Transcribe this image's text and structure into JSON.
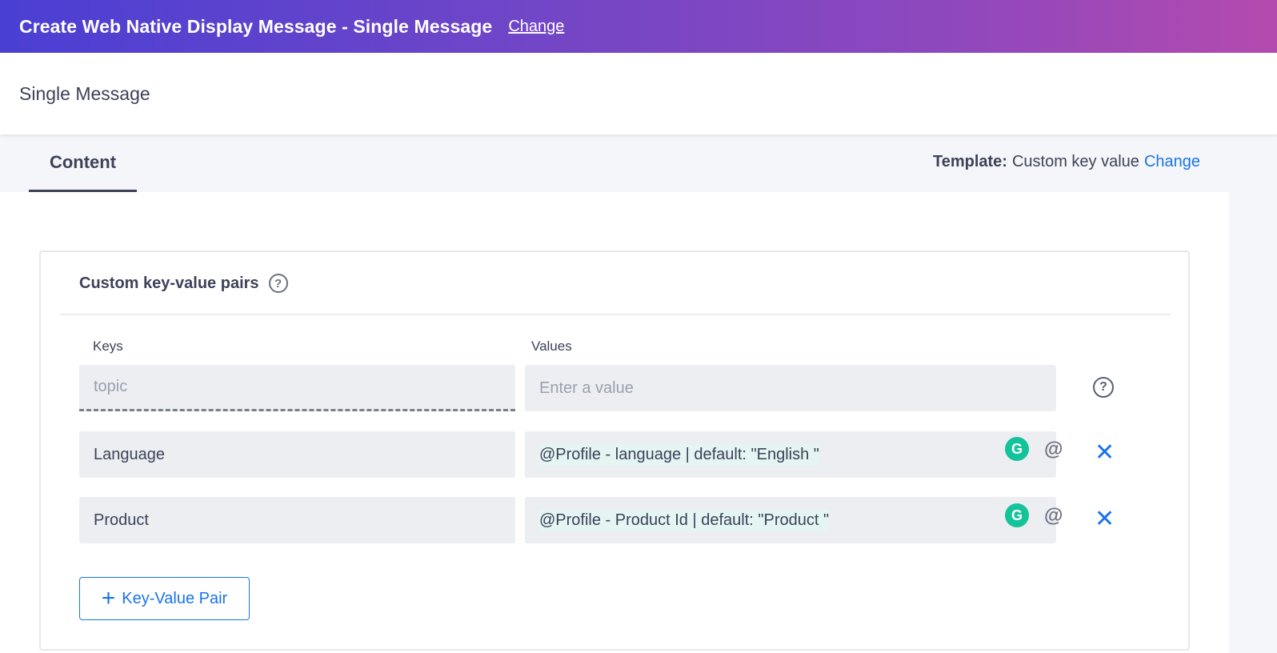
{
  "topbar": {
    "title": "Create Web Native Display Message - Single Message",
    "change_label": "Change"
  },
  "subheader": {
    "title": "Single Message"
  },
  "tabs": {
    "content_label": "Content"
  },
  "template": {
    "label": "Template:",
    "value": "Custom key value",
    "change_label": "Change"
  },
  "card": {
    "title": "Custom key-value pairs",
    "help_glyph": "?",
    "keys_header": "Keys",
    "values_header": "Values",
    "new_row": {
      "key_placeholder": "topic",
      "value_placeholder": "Enter a value"
    },
    "rows": [
      {
        "key": "Language",
        "value": "@Profile - language | default: \"English \""
      },
      {
        "key": "Product",
        "value": "@Profile - Product Id | default: \"Product \""
      }
    ],
    "add_button_label": "Key-Value Pair",
    "add_button_icon": "+",
    "at_glyph": "@",
    "remove_glyph": "✕",
    "grammarly_glyph": "G"
  },
  "colors": {
    "accent": "#1a73e8",
    "gradient_start": "#4a3fd3",
    "gradient_end": "#b44aaf",
    "grammarly": "#15c39a"
  }
}
